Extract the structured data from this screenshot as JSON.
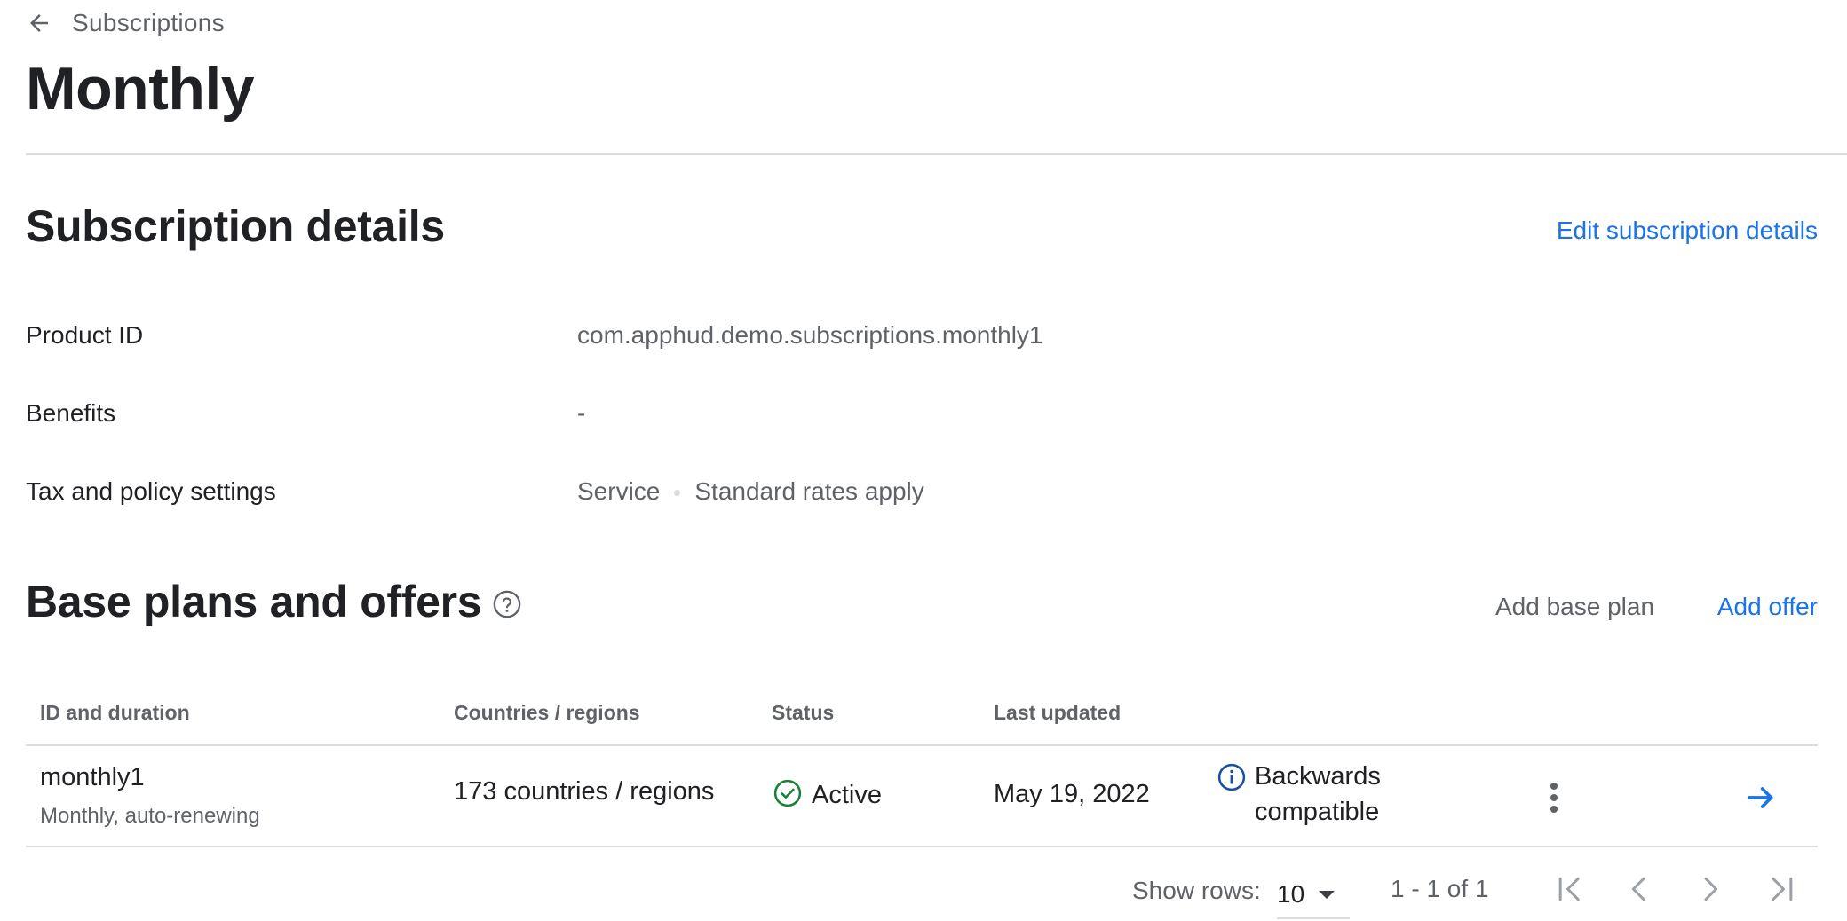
{
  "header": {
    "back_label": "Subscriptions",
    "title": "Monthly"
  },
  "details": {
    "title": "Subscription details",
    "edit_link": "Edit subscription details",
    "rows": [
      {
        "label": "Product ID",
        "value": "com.apphud.demo.subscriptions.monthly1"
      },
      {
        "label": "Benefits",
        "value": "-"
      },
      {
        "label": "Tax and policy settings",
        "value_parts": [
          "Service",
          "Standard rates apply"
        ]
      }
    ]
  },
  "plans": {
    "title": "Base plans and offers",
    "add_base_plan": "Add base plan",
    "add_offer": "Add offer",
    "columns": [
      "ID and duration",
      "Countries / regions",
      "Status",
      "Last updated"
    ],
    "rows": [
      {
        "id": "monthly1",
        "duration": "Monthly, auto-renewing",
        "countries": "173 countries / regions",
        "status": "Active",
        "last_updated": "May 19, 2022",
        "compat_line1": "Backwards",
        "compat_line2": "compatible"
      }
    ]
  },
  "pagination": {
    "show_rows_label": "Show rows:",
    "rows_value": "10",
    "range": "1 - 1 of 1"
  },
  "colors": {
    "accent": "#1a73e8",
    "status_active": "#188038",
    "info_icon": "#174ea6",
    "divider": "#dadce0",
    "text_secondary": "#5f6368"
  }
}
